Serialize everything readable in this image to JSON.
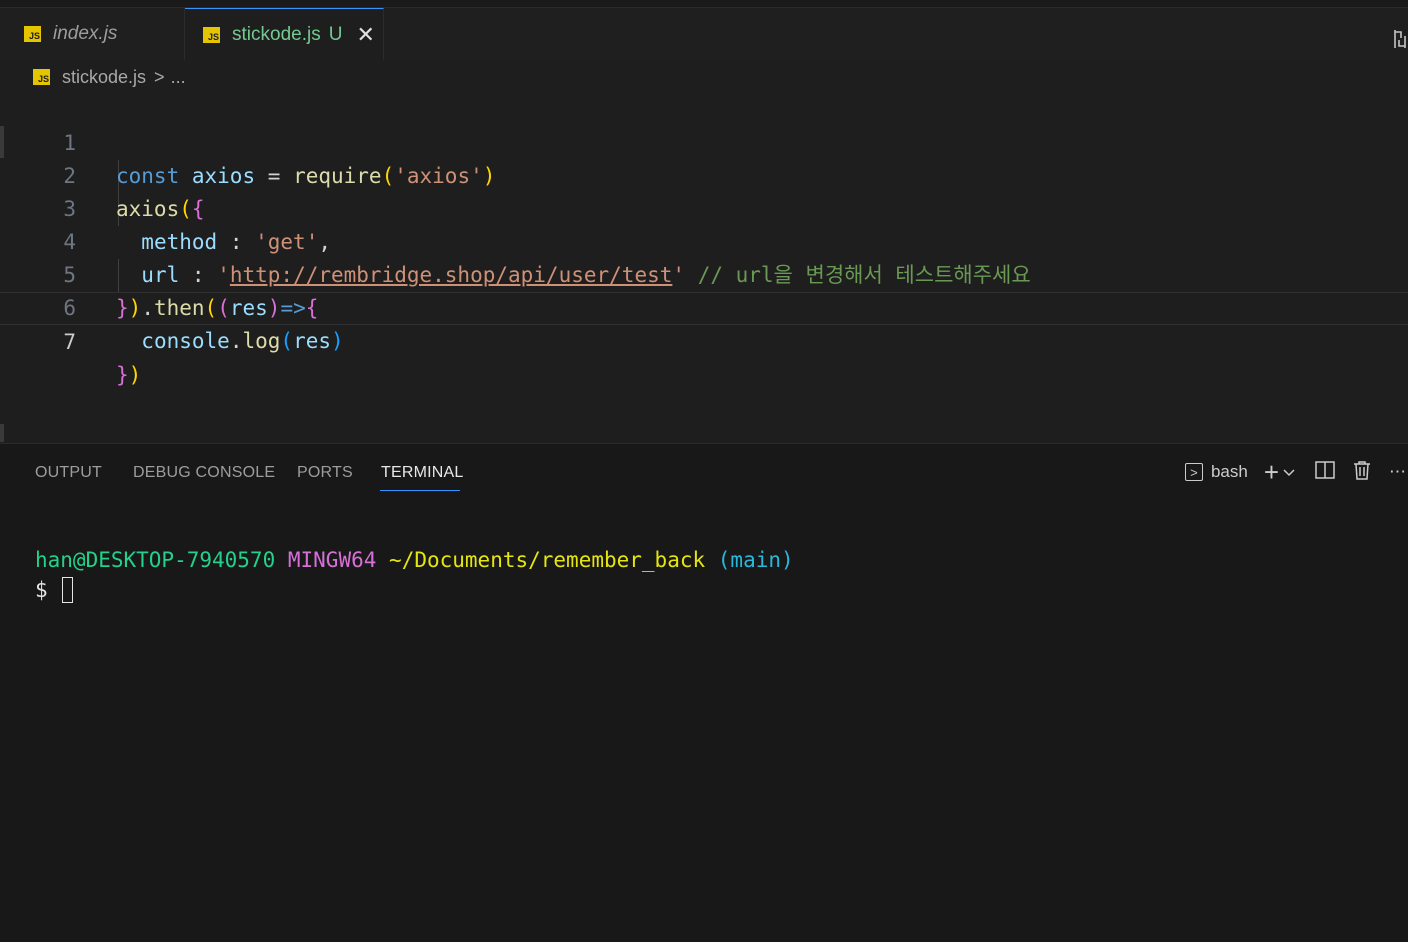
{
  "tabs": [
    {
      "icon": "JS",
      "label": "index.js"
    },
    {
      "icon": "JS",
      "label": "stickode.js",
      "badge": "U",
      "close": "✕"
    }
  ],
  "breadcrumb": {
    "icon": "JS",
    "file": "stickode.js",
    "sep": ">",
    "rest": "..."
  },
  "editor": {
    "line_numbers": [
      "1",
      "2",
      "3",
      "4",
      "5",
      "6",
      "7"
    ],
    "lines": [
      "const axios = require('axios')",
      "axios({",
      "  method : 'get',",
      "  url : 'http://rembridge.shop/api/user/test' // url을 변경해서 테스트해주세요",
      "}).then((res)=>{",
      "  console.log(res)",
      "})"
    ],
    "tokens": {
      "const": "const",
      "axios": "axios",
      "eq": "=",
      "require": "require",
      "axios_str": "'axios'",
      "method": "method",
      "colon": ":",
      "get_str": "'get'",
      "url": "url",
      "url_value": "http://rembridge.shop/api/user/test",
      "comment": "// url을 변경해서 테스트해주세요",
      "then": "then",
      "res": "res",
      "arrow": "=>",
      "console": "console",
      "log": "log"
    }
  },
  "panel": {
    "tabs": [
      "OUTPUT",
      "DEBUG CONSOLE",
      "PORTS",
      "TERMINAL"
    ],
    "active_tab": "TERMINAL",
    "shell": "bash",
    "terminal": {
      "user_host": "han@DESKTOP-7940570",
      "system": "MINGW64",
      "path": "~/Documents/remember_back",
      "branch": "(main)",
      "prompt": "$"
    }
  }
}
